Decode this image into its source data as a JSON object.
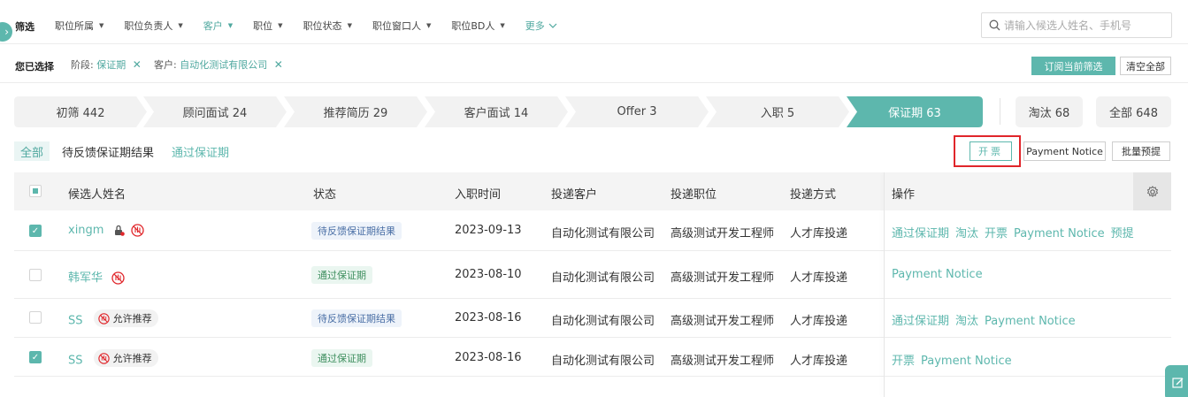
{
  "filter_bar": {
    "title": "筛选",
    "filters": [
      {
        "label": "职位所属",
        "active": false
      },
      {
        "label": "职位负责人",
        "active": false
      },
      {
        "label": "客户",
        "active": true
      },
      {
        "label": "职位",
        "active": false
      },
      {
        "label": "职位状态",
        "active": false
      },
      {
        "label": "职位窗口人",
        "active": false
      },
      {
        "label": "职位BD人",
        "active": false
      },
      {
        "label": "更多",
        "active": true
      }
    ],
    "search_placeholder": "请输入候选人姓名、手机号"
  },
  "selected": {
    "label": "您已选择",
    "chips": [
      {
        "key": "阶段:",
        "value": "保证期"
      },
      {
        "key": "客户:",
        "value": "自动化测试有限公司"
      }
    ],
    "subscribe_label": "订阅当前筛选",
    "clear_label": "清空全部"
  },
  "stages": [
    {
      "label": "初筛 442"
    },
    {
      "label": "顾问面试 24"
    },
    {
      "label": "推荐简历 29"
    },
    {
      "label": "客户面试 14"
    },
    {
      "label": "Offer 3"
    },
    {
      "label": "入职 5"
    },
    {
      "label": "保证期 63"
    }
  ],
  "extra_stages": [
    {
      "label": "淘汰 68"
    },
    {
      "label": "全部 648"
    }
  ],
  "sub_tabs": [
    "全部",
    "待反馈保证期结果",
    "通过保证期"
  ],
  "actions": {
    "invoice": "开票",
    "payment_notice": "Payment Notice",
    "batch_withdraw": "批量预提"
  },
  "table": {
    "headers": [
      "候选人姓名",
      "状态",
      "入职时间",
      "投递客户",
      "投递职位",
      "投递方式",
      "操作"
    ],
    "rows": [
      {
        "checked": true,
        "name": "xingm",
        "lock_icon": true,
        "allow_label": "",
        "status": "待反馈保证期结果",
        "status_type": "pending",
        "date": "2023-09-13",
        "client": "自动化测试有限公司",
        "position": "高级测试开发工程师",
        "method": "人才库投递",
        "ops": [
          "通过保证期",
          "淘汰",
          "开票",
          "Payment Notice",
          "预提"
        ]
      },
      {
        "checked": false,
        "name": "韩军华",
        "lock_icon": false,
        "allow_label": "",
        "status": "通过保证期",
        "status_type": "passed",
        "date": "2023-08-10",
        "client": "自动化测试有限公司",
        "position": "高级测试开发工程师",
        "method": "人才库投递",
        "ops": [
          "Payment Notice"
        ]
      },
      {
        "checked": false,
        "name": "SS",
        "lock_icon": false,
        "allow_label": "允许推荐",
        "status": "待反馈保证期结果",
        "status_type": "pending",
        "date": "2023-08-16",
        "client": "自动化测试有限公司",
        "position": "高级测试开发工程师",
        "method": "人才库投递",
        "ops": [
          "通过保证期",
          "淘汰",
          "Payment Notice"
        ]
      },
      {
        "checked": true,
        "name": "SS",
        "lock_icon": false,
        "allow_label": "允许推荐",
        "status": "通过保证期",
        "status_type": "passed",
        "date": "2023-08-16",
        "client": "自动化测试有限公司",
        "position": "高级测试开发工程师",
        "method": "人才库投递",
        "ops": [
          "开票",
          "Payment Notice"
        ]
      }
    ]
  },
  "colors": {
    "accent": "#5db7ad",
    "highlight": "#e0262b"
  }
}
